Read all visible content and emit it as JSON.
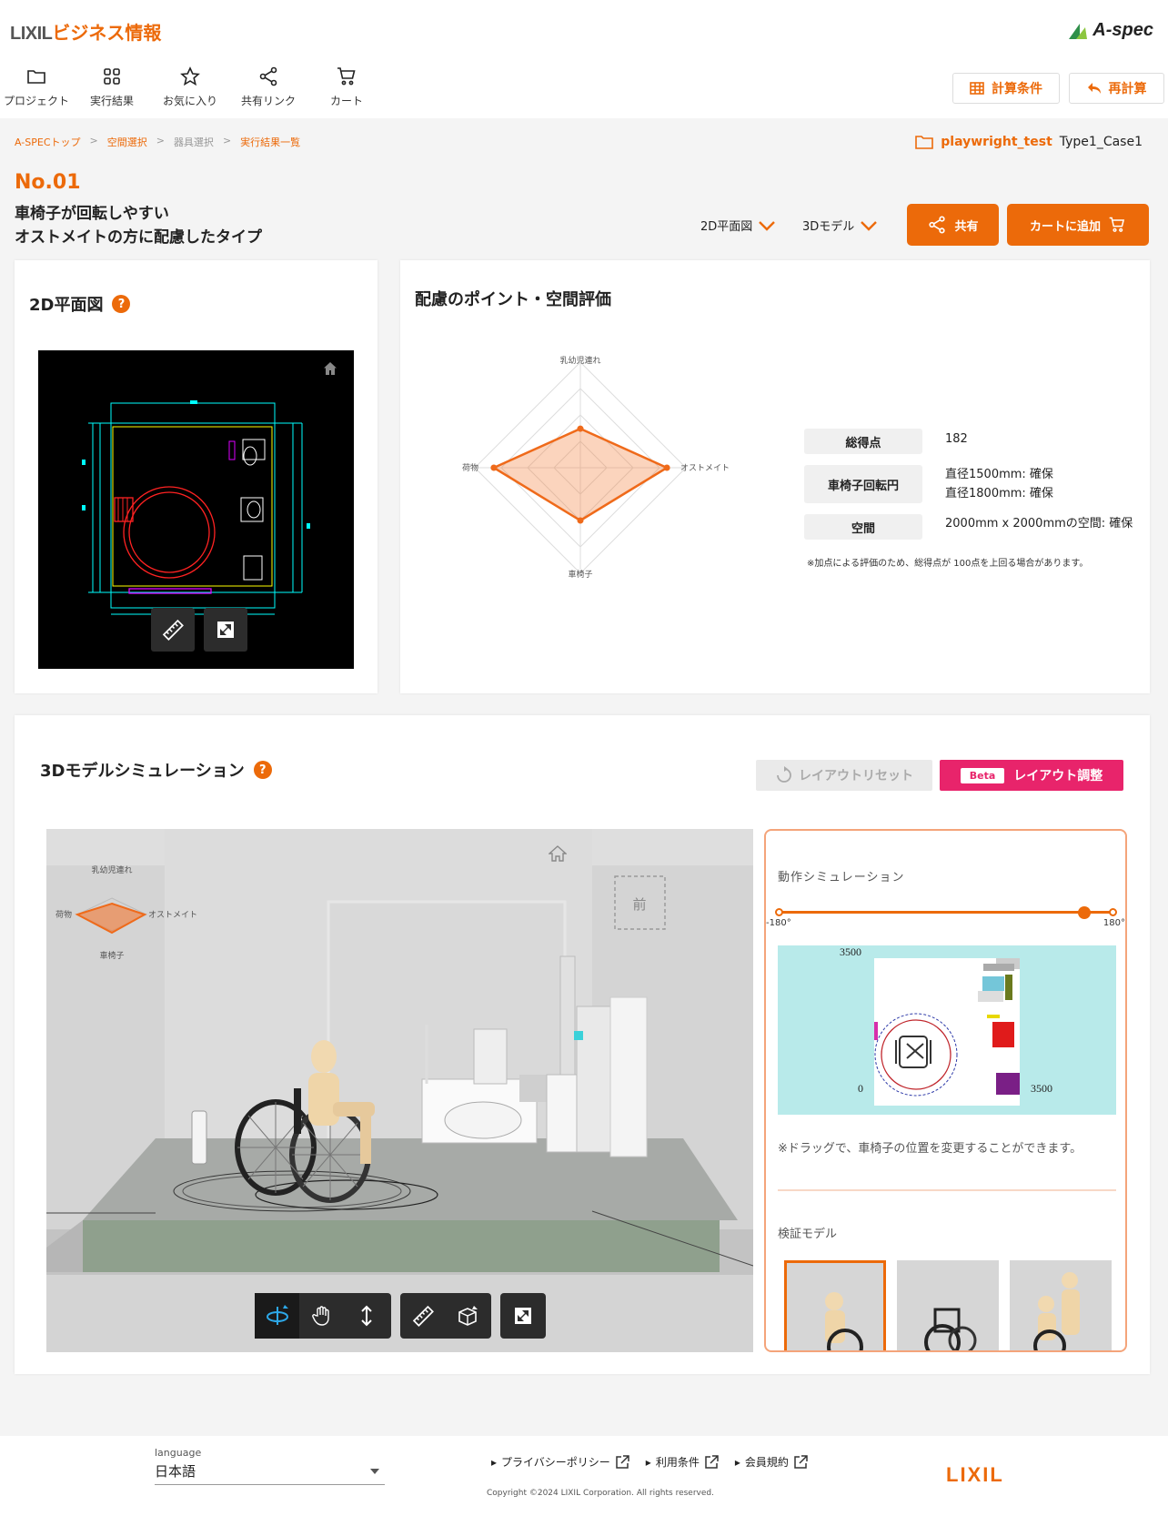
{
  "header": {
    "brand_lixil": "LIXIL",
    "brand_business": "ビジネス情報",
    "aspec_logo": "A-spec",
    "nav": [
      "プロジェクト",
      "実行結果",
      "お気に入り",
      "共有リンク",
      "カート"
    ],
    "calc_conditions": "計算条件",
    "recalc": "再計算"
  },
  "breadcrumb": [
    "A-SPECトップ",
    "空間選択",
    "器具選択",
    "実行結果一覧"
  ],
  "breadcrumb_sep": ">",
  "project": {
    "name": "playwright_test",
    "case": "Type1_Case1"
  },
  "result": {
    "number": "No.01",
    "line1": "車椅子が回転しやすい",
    "line2": "オストメイトの方に配慮したタイプ",
    "dropdown_2d": "2D平面図",
    "dropdown_3d": "3Dモデル",
    "share": "共有",
    "add_cart": "カートに追加"
  },
  "plan_card": {
    "title": "2D平面図",
    "help": "?"
  },
  "eval_card": {
    "title": "配慮のポイント・空間評価",
    "radar_axes": [
      "乳幼児連れ",
      "オストメイト",
      "車椅子",
      "荷物"
    ],
    "radar_values": [
      0.37,
      0.82,
      0.5,
      0.82
    ],
    "scores": [
      {
        "label": "総得点",
        "value": [
          "182"
        ]
      },
      {
        "label": "車椅子回転円",
        "value": [
          "直径1500mm: 確保",
          "直径1800mm: 確保"
        ]
      },
      {
        "label": "空間",
        "value": [
          "2000mm x 2000mmの空間: 確保"
        ]
      }
    ],
    "note": "※加点による評価のため、総得点が 100点を上回る場合があります。"
  },
  "sim3d": {
    "title": "3Dモデルシミュレーション",
    "help": "?",
    "reset": "レイアウトリセット",
    "beta": "Beta",
    "adjust": "レイアウト調整",
    "front": "前",
    "mini_axes": [
      "乳幼児連れ",
      "オストメイト",
      "車椅子",
      "荷物"
    ]
  },
  "motion": {
    "title": "動作シミュレーション",
    "min": "-180°",
    "max": "180°",
    "value_fraction": 0.91,
    "axis_top": "3500",
    "axis_origin": "0",
    "axis_right": "3500",
    "drag_note": "※ドラッグで、車椅子の位置を変更することができます。",
    "models_title": "検証モデル"
  },
  "footer": {
    "language_label": "language",
    "language_value": "日本語",
    "links": [
      "プライバシーポリシー",
      "利用条件",
      "会員規約"
    ],
    "copyright": "Copyright ©2024 LIXIL Corporation. All rights reserved.",
    "logo": "LIXIL"
  },
  "colors": {
    "accent": "#ec6a0a",
    "pink": "#e8246b",
    "sim_bg": "#b8eaea"
  }
}
